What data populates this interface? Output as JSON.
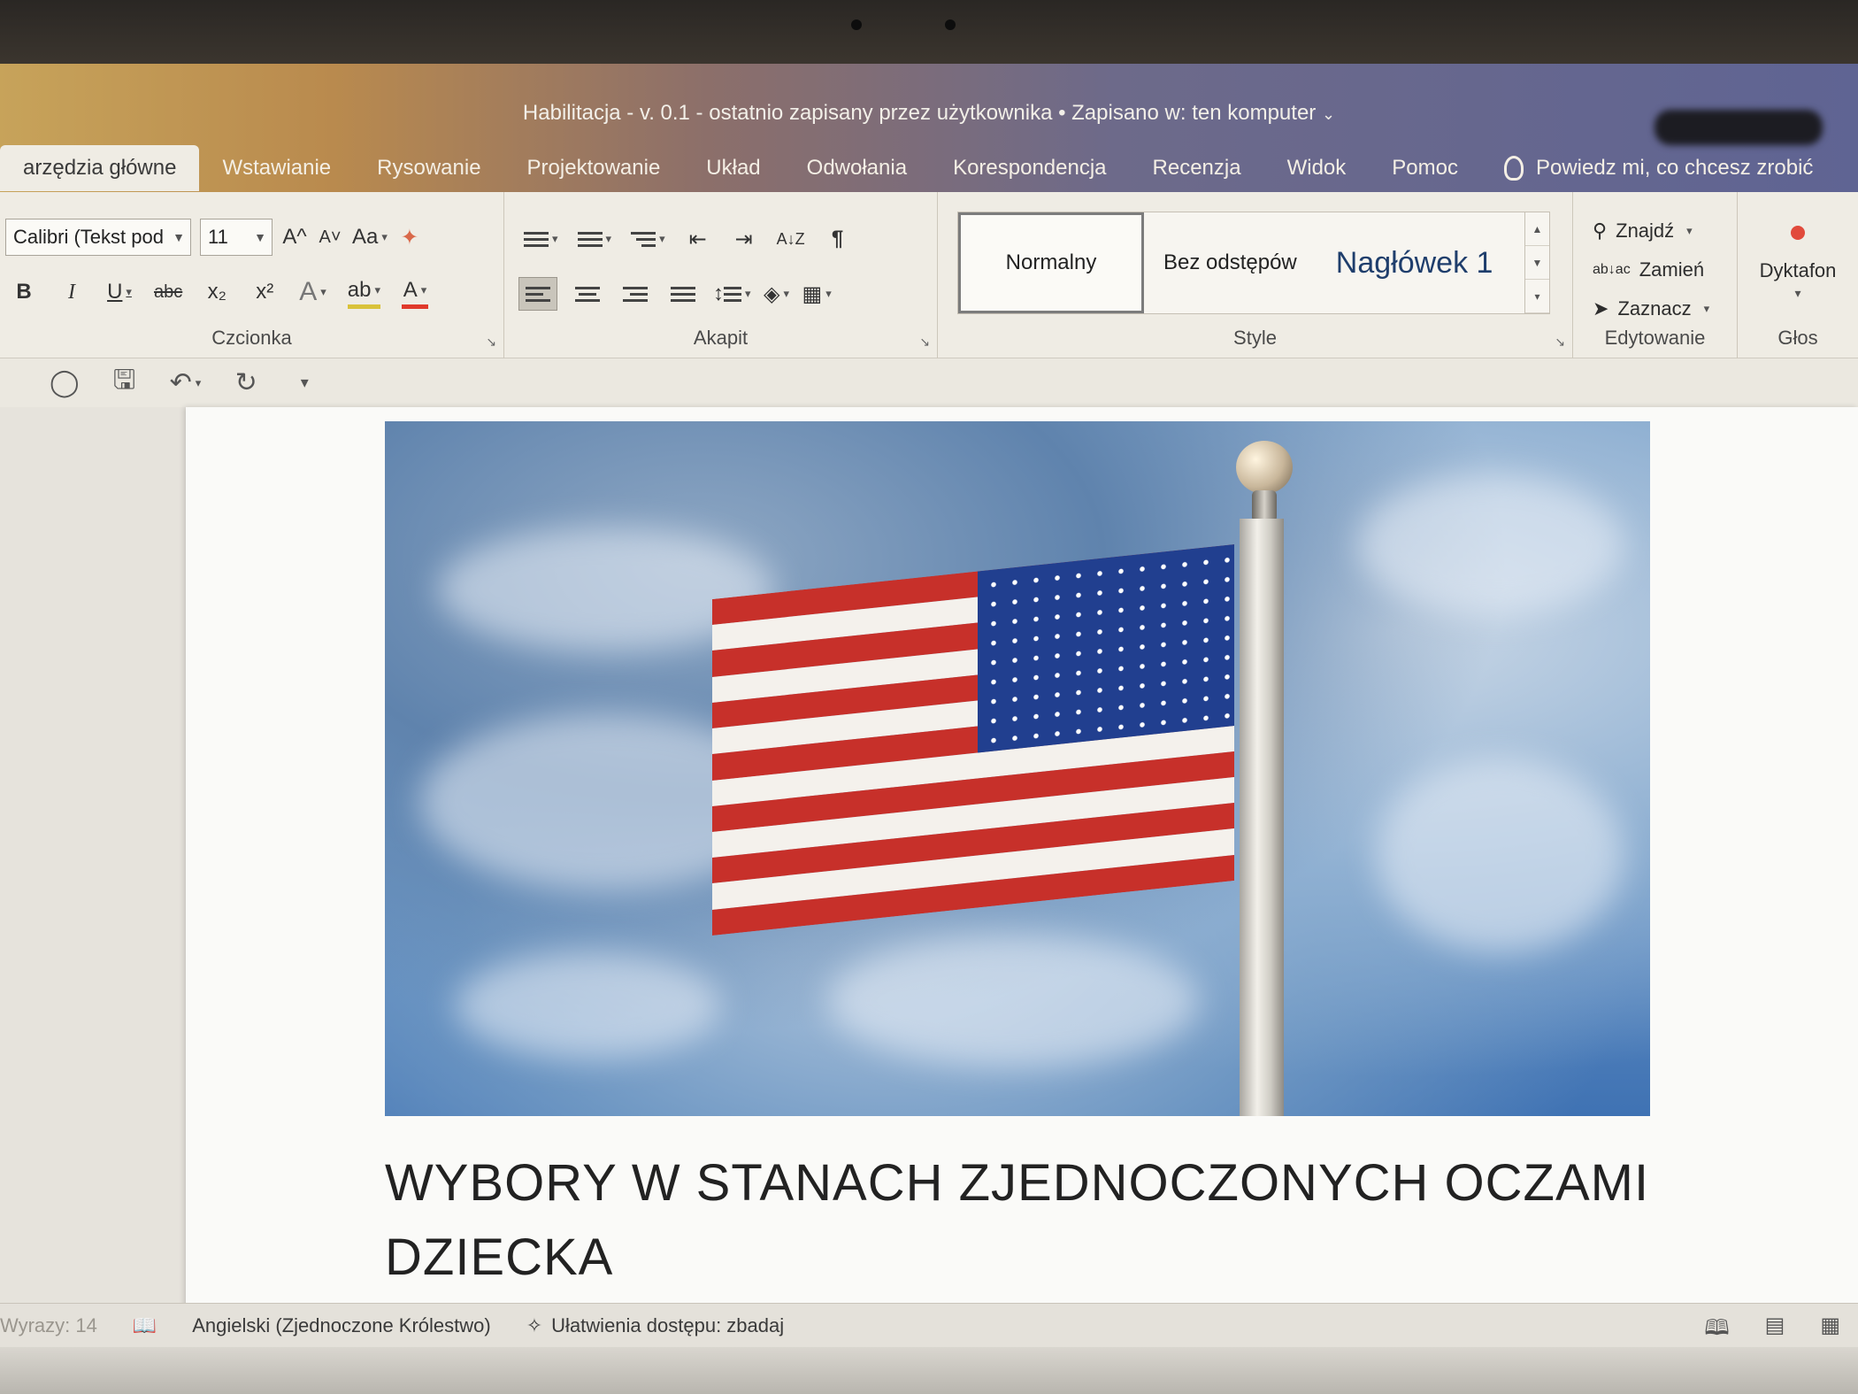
{
  "window": {
    "title": "Habilitacja - v. 0.1  -  ostatnio zapisany przez użytkownika  •  Zapisano w: ten komputer"
  },
  "tabs": [
    {
      "label": "arzędzia główne",
      "active": true
    },
    {
      "label": "Wstawianie"
    },
    {
      "label": "Rysowanie"
    },
    {
      "label": "Projektowanie"
    },
    {
      "label": "Układ"
    },
    {
      "label": "Odwołania"
    },
    {
      "label": "Korespondencja"
    },
    {
      "label": "Recenzja"
    },
    {
      "label": "Widok"
    },
    {
      "label": "Pomoc"
    }
  ],
  "tell_me": "Powiedz mi, co chcesz zrobić",
  "ribbon": {
    "font": {
      "family": "Calibri (Tekst pod",
      "size": "11",
      "grow": "A^",
      "shrink": "A˅",
      "case": "Aa",
      "bold": "B",
      "italic": "I",
      "underline": "U",
      "strike": "abc",
      "subscript": "x₂",
      "superscript": "x²",
      "group_label": "Czcionka"
    },
    "paragraph": {
      "sort": "A↓Z",
      "pilcrow": "¶",
      "group_label": "Akapit"
    },
    "styles": {
      "items": [
        "Normalny",
        "Bez odstępów",
        "Nagłówek 1"
      ],
      "group_label": "Style"
    },
    "editing": {
      "find": "Znajdź",
      "replace": "Zamień",
      "select": "Zaznacz",
      "group_label": "Edytowanie"
    },
    "voice": {
      "dictate": "Dyktafon",
      "group_label": "Głos"
    }
  },
  "document": {
    "heading": "WYBORY W STANACH ZJEDNOCZONYCH  OCZAMI DZIECKA",
    "image_alt": "american-flag-photo"
  },
  "status": {
    "words": "Wyrazy: 14",
    "language": "Angielski (Zjednoczone Królestwo)",
    "accessibility": "Ułatwienia dostępu: zbadaj"
  },
  "colors": {
    "accent_tab_bar": "#6d6a8a",
    "font_color": "#e0392b",
    "highlight": "#d9c23a",
    "record": "#e14a3b"
  }
}
